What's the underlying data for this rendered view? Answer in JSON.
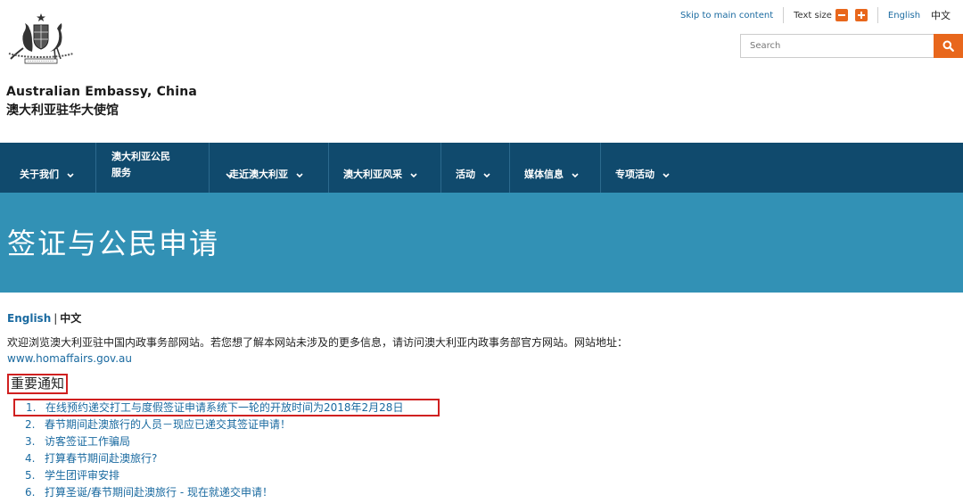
{
  "util": {
    "skip_label": "Skip to main content",
    "text_size_label": "Text size",
    "lang_en": "English",
    "lang_zh": "中文"
  },
  "search": {
    "placeholder": "Search"
  },
  "site": {
    "title_en": "Australian Embassy, China",
    "title_zh": "澳大利亚驻华大使馆"
  },
  "nav": {
    "items": [
      {
        "label": "关于我们"
      },
      {
        "label_line1": "澳大利亚公民",
        "label_line2": "服务"
      },
      {
        "label": "走近澳大利亚"
      },
      {
        "label": "澳大利亚风采"
      },
      {
        "label": "活动"
      },
      {
        "label": "媒体信息"
      },
      {
        "label": "专项活动"
      }
    ]
  },
  "banner": {
    "title": "签证与公民申请"
  },
  "content": {
    "lang_en": "English",
    "lang_sep": "|",
    "lang_zh": "中文",
    "intro_text": "欢迎浏览澳大利亚驻中国内政事务部网站。若您想了解本网站未涉及的更多信息，请访问澳大利亚内政事务部官方网站。网站地址：",
    "intro_link": "www.homaffairs.gov.au",
    "notice_title": "重要通知",
    "notices": [
      {
        "num": "1.",
        "text": "在线预约递交打工与度假签证申请系统下一轮的开放时间为2018年2月28日"
      },
      {
        "num": "2.",
        "text": "春节期间赴澳旅行的人员－现应已递交其签证申请！"
      },
      {
        "num": "3.",
        "text": "访客签证工作骗局"
      },
      {
        "num": "4.",
        "text": "打算春节期间赴澳旅行?"
      },
      {
        "num": "5.",
        "text": "学生团评审安排"
      },
      {
        "num": "6.",
        "text": "打算圣诞/春节期间赴澳旅行 - 现在就递交申请！"
      }
    ]
  },
  "colors": {
    "nav_bg": "#104a6d",
    "banner_bg": "#3291b5",
    "accent_orange": "#e8671c",
    "link_blue": "#1a6aa0",
    "highlight_red": "#d02020"
  },
  "icons": {
    "crest": "coat-of-arms-icon",
    "search": "search-icon",
    "text_smaller": "minus-icon",
    "text_larger": "plus-icon",
    "nav_chevron": "chevron-down-icon"
  }
}
